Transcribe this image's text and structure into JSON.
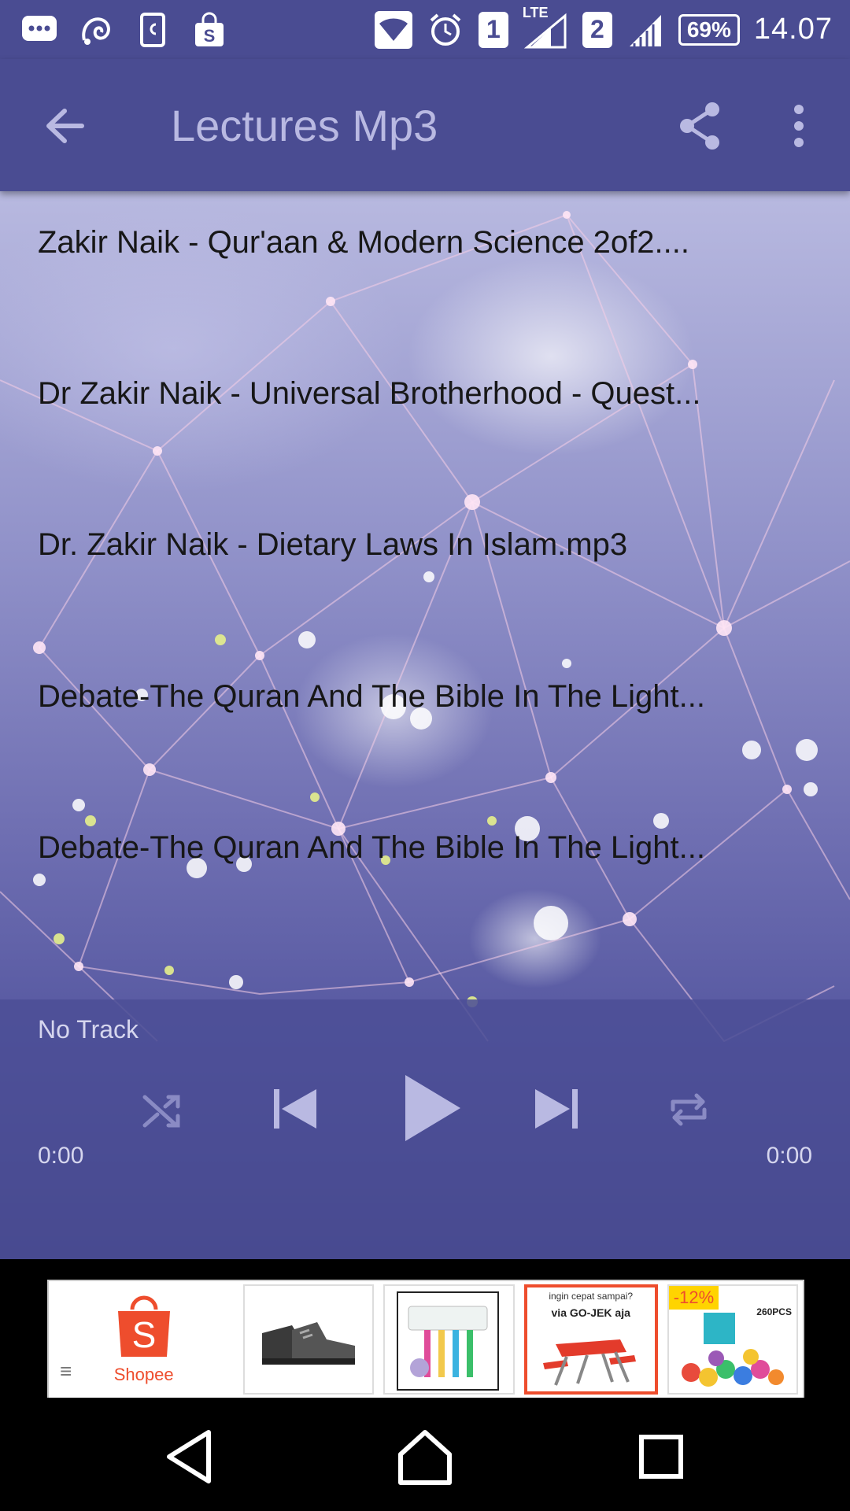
{
  "status_bar": {
    "battery": "69%",
    "time": "14.07",
    "sim1": "1",
    "sim2": "2",
    "network": "LTE",
    "icons": [
      "messenger-icon",
      "uc-browser-icon",
      "clip-icon",
      "shopping-bag-icon",
      "wifi-icon",
      "alarm-icon",
      "signal-icon"
    ]
  },
  "app_bar": {
    "title": "Lectures Mp3",
    "icons": [
      "back-arrow-icon",
      "share-icon",
      "more-vert-icon"
    ]
  },
  "tracks": [
    "Zakir Naik - Qur'aan & Modern Science 2of2....",
    "Dr Zakir Naik - Universal Brotherhood - Quest...",
    "Dr. Zakir Naik - Dietary Laws In Islam.mp3",
    "Debate-The Quran And The Bible In The Light...",
    "Debate-The Quran And The Bible In The Light..."
  ],
  "player": {
    "now_playing": "No Track",
    "elapsed": "0:00",
    "duration": "0:00",
    "controls": [
      "shuffle-icon",
      "previous-icon",
      "play-icon",
      "next-icon",
      "repeat-icon"
    ]
  },
  "ad": {
    "brand": "Shopee",
    "brand_letter": "S",
    "items": [
      {
        "icon": "boots-icon"
      },
      {
        "icon": "toothbrush-holder-icon"
      },
      {
        "icon": "folding-table-icon",
        "caption": "ingin cepat sampai?",
        "sub": "via GO-JEK aja"
      },
      {
        "icon": "toy-blocks-icon",
        "badge": "-12%",
        "count": "260PCS"
      }
    ],
    "colors": {
      "brand": "#ee4d2d"
    }
  },
  "colors": {
    "primary": "#4a4c92",
    "title_text": "#b9b9e2",
    "track_text": "#171717"
  }
}
